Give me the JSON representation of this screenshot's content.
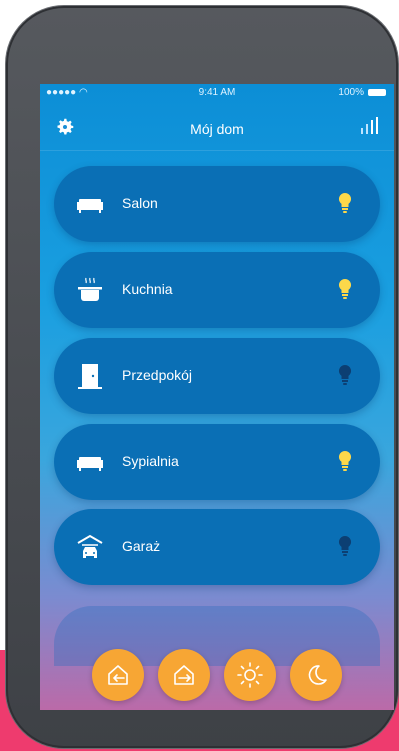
{
  "status": {
    "carrier": "●●●●● ◠",
    "time": "9:41 AM",
    "battery": "100%"
  },
  "header": {
    "title": "Mój dom"
  },
  "rooms": [
    {
      "label": "Salon",
      "icon": "sofa-icon",
      "light_on": true
    },
    {
      "label": "Kuchnia",
      "icon": "pot-icon",
      "light_on": true
    },
    {
      "label": "Przedpokój",
      "icon": "door-icon",
      "light_on": false
    },
    {
      "label": "Sypialnia",
      "icon": "sofa-icon",
      "light_on": true
    },
    {
      "label": "Garaż",
      "icon": "car-garage-icon",
      "light_on": false
    }
  ],
  "actions": [
    {
      "icon": "enter-home-icon"
    },
    {
      "icon": "leave-home-icon"
    },
    {
      "icon": "sun-icon"
    },
    {
      "icon": "moon-icon"
    }
  ],
  "colors": {
    "accent": "#f7a634",
    "bulb_on": "#fcd84a",
    "bulb_off": "#0c3f73",
    "card": "#0a6fb5",
    "pink": "#ee3b6e"
  }
}
